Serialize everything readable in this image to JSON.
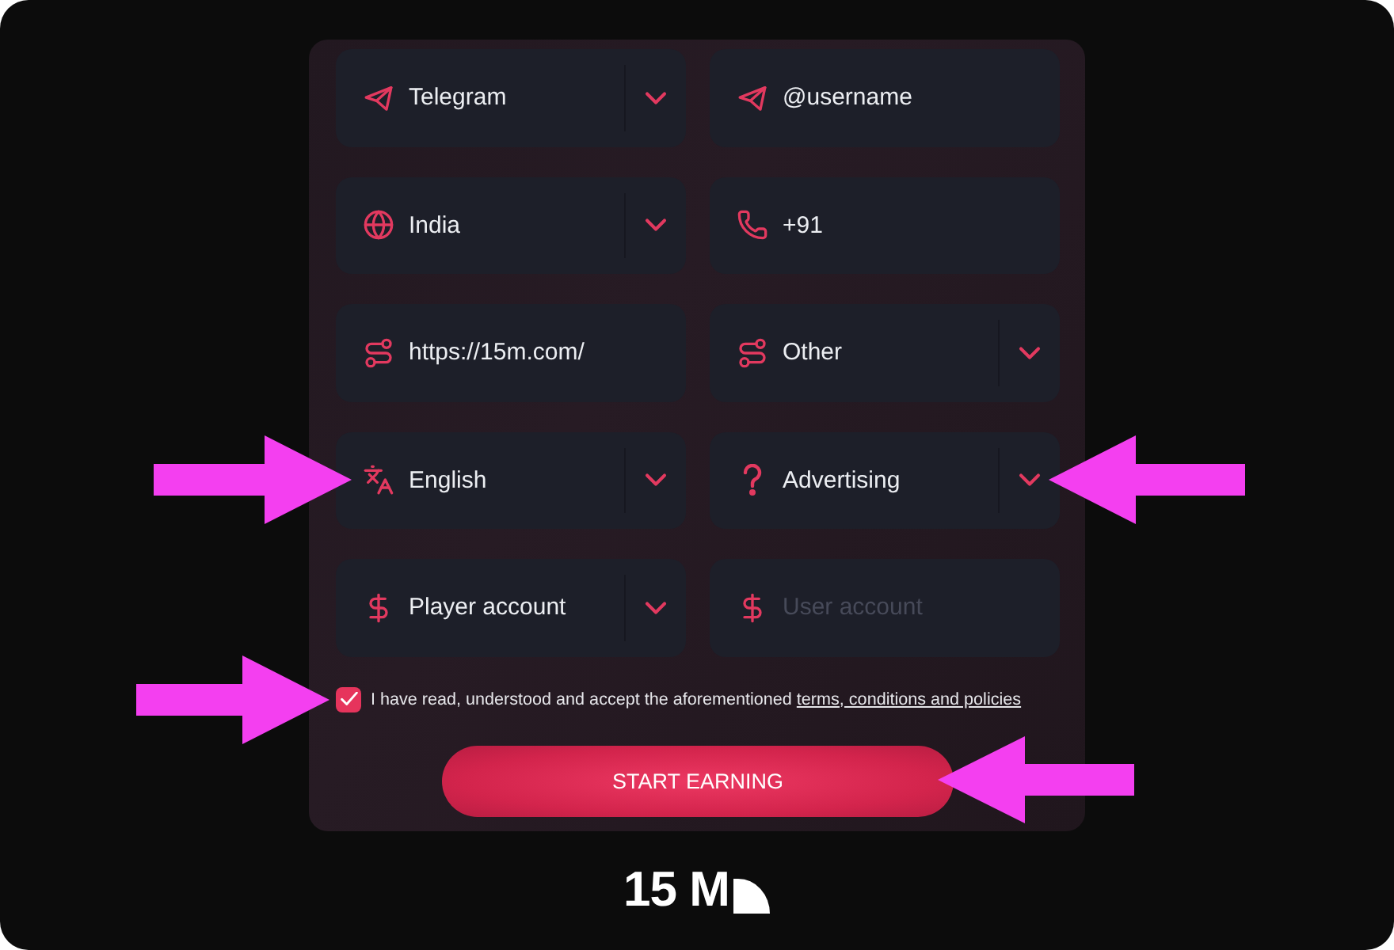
{
  "form": {
    "fields": [
      {
        "kind": "select",
        "value": "Telegram"
      },
      {
        "kind": "input",
        "value": "@username"
      },
      {
        "kind": "select",
        "value": "India"
      },
      {
        "kind": "input",
        "value": "+91"
      },
      {
        "kind": "input",
        "value": "https://15m.com/"
      },
      {
        "kind": "select",
        "value": "Other"
      },
      {
        "kind": "select",
        "value": "English"
      },
      {
        "kind": "select",
        "value": "Advertising"
      },
      {
        "kind": "select",
        "value": "Player account"
      },
      {
        "kind": "input",
        "placeholder": "User account"
      }
    ]
  },
  "agreement": {
    "checked": true,
    "text": "I have read, understood and accept the aforementioned",
    "link": "terms, conditions and policies"
  },
  "submit_button": {
    "label": "START EARNING"
  },
  "logo": {
    "text": "15 M"
  }
}
